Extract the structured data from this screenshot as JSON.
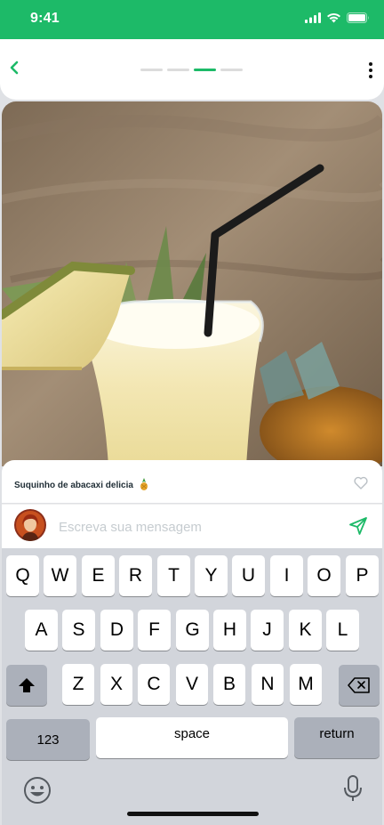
{
  "status_bar": {
    "time": "9:41",
    "icons": [
      "cellular-signal-icon",
      "wifi-icon",
      "battery-icon"
    ]
  },
  "nav": {
    "back_icon": "chevron-left-icon",
    "more_icon": "more-vertical-icon",
    "progress": {
      "total": 4,
      "active_index": 2
    }
  },
  "post": {
    "caption": "Suquinho de abacaxi delicia",
    "caption_emoji": "pineapple-icon",
    "like_icon": "heart-outline-icon"
  },
  "composer": {
    "placeholder": "Escreva sua mensagem",
    "value": "",
    "send_icon": "send-icon"
  },
  "keyboard": {
    "row1": [
      "Q",
      "W",
      "E",
      "R",
      "T",
      "Y",
      "U",
      "I",
      "O",
      "P"
    ],
    "row2": [
      "A",
      "S",
      "D",
      "F",
      "G",
      "H",
      "J",
      "K",
      "L"
    ],
    "row3": [
      "Z",
      "X",
      "C",
      "V",
      "B",
      "N",
      "M"
    ],
    "numbers_label": "123",
    "space_label": "space",
    "return_label": "return",
    "shift_icon": "shift-icon",
    "delete_icon": "delete-icon",
    "emoji_icon": "emoji-icon",
    "mic_icon": "microphone-icon"
  },
  "colors": {
    "brand": "#1dba68",
    "keyboard_bg": "#d2d5db",
    "function_key": "#abb0ba"
  }
}
